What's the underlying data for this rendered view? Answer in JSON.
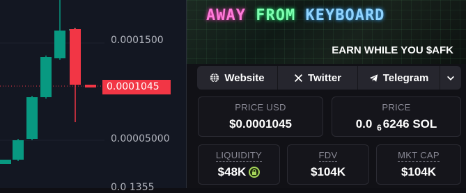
{
  "chart": {
    "price_labels": [
      "0.0001500",
      "0.00005000",
      "0.0 1355"
    ],
    "current_price_tag": "0.0001045",
    "colors": {
      "up": "#089981",
      "down": "#f23645",
      "axis_text": "#b2b5be"
    }
  },
  "banner": {
    "title_words": [
      "AWAY",
      "FROM",
      "KEYBOARD"
    ],
    "tagline": "EARN WHILE YOU $AFK"
  },
  "links": {
    "website": "Website",
    "twitter": "Twitter",
    "telegram": "Telegram",
    "more_icon": "chevron-down-icon"
  },
  "stats": {
    "price_usd": {
      "label": "PRICE USD",
      "value": "$0.0001045"
    },
    "price": {
      "label": "PRICE",
      "value_prefix": "0.0",
      "zeros": "6",
      "value_suffix": "6246 SOL"
    },
    "liquidity": {
      "label": "LIQUIDITY",
      "value": "$48K"
    },
    "fdv": {
      "label": "FDV",
      "value": "$104K"
    },
    "mkt_cap": {
      "label": "MKT CAP",
      "value": "$104K"
    }
  }
}
